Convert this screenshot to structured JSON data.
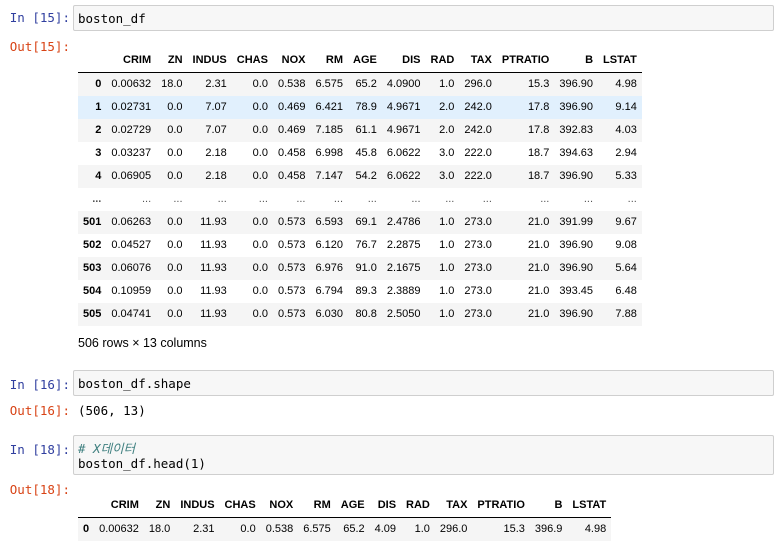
{
  "cells": {
    "c15": {
      "in_prompt": "In [15]:",
      "code": "boston_df",
      "out_prompt": "Out[15]:"
    },
    "c16": {
      "in_prompt": "In [16]:",
      "code": "boston_df.shape",
      "out_prompt": "Out[16]:",
      "output": "(506, 13)"
    },
    "c18": {
      "in_prompt": "In [18]:",
      "comment": "# X데이터",
      "code": "boston_df.head(1)",
      "out_prompt": "Out[18]:"
    }
  },
  "df1": {
    "columns": [
      "CRIM",
      "ZN",
      "INDUS",
      "CHAS",
      "NOX",
      "RM",
      "AGE",
      "DIS",
      "RAD",
      "TAX",
      "PTRATIO",
      "B",
      "LSTAT"
    ],
    "rows": [
      {
        "index": "0",
        "values": [
          "0.00632",
          "18.0",
          "2.31",
          "0.0",
          "0.538",
          "6.575",
          "65.2",
          "4.0900",
          "1.0",
          "296.0",
          "15.3",
          "396.90",
          "4.98"
        ]
      },
      {
        "index": "1",
        "values": [
          "0.02731",
          "0.0",
          "7.07",
          "0.0",
          "0.469",
          "6.421",
          "78.9",
          "4.9671",
          "2.0",
          "242.0",
          "17.8",
          "396.90",
          "9.14"
        ]
      },
      {
        "index": "2",
        "values": [
          "0.02729",
          "0.0",
          "7.07",
          "0.0",
          "0.469",
          "7.185",
          "61.1",
          "4.9671",
          "2.0",
          "242.0",
          "17.8",
          "392.83",
          "4.03"
        ]
      },
      {
        "index": "3",
        "values": [
          "0.03237",
          "0.0",
          "2.18",
          "0.0",
          "0.458",
          "6.998",
          "45.8",
          "6.0622",
          "3.0",
          "222.0",
          "18.7",
          "394.63",
          "2.94"
        ]
      },
      {
        "index": "4",
        "values": [
          "0.06905",
          "0.0",
          "2.18",
          "0.0",
          "0.458",
          "7.147",
          "54.2",
          "6.0622",
          "3.0",
          "222.0",
          "18.7",
          "396.90",
          "5.33"
        ]
      },
      {
        "index": "...",
        "values": [
          "...",
          "...",
          "...",
          "...",
          "...",
          "...",
          "...",
          "...",
          "...",
          "...",
          "...",
          "...",
          "..."
        ]
      },
      {
        "index": "501",
        "values": [
          "0.06263",
          "0.0",
          "11.93",
          "0.0",
          "0.573",
          "6.593",
          "69.1",
          "2.4786",
          "1.0",
          "273.0",
          "21.0",
          "391.99",
          "9.67"
        ]
      },
      {
        "index": "502",
        "values": [
          "0.04527",
          "0.0",
          "11.93",
          "0.0",
          "0.573",
          "6.120",
          "76.7",
          "2.2875",
          "1.0",
          "273.0",
          "21.0",
          "396.90",
          "9.08"
        ]
      },
      {
        "index": "503",
        "values": [
          "0.06076",
          "0.0",
          "11.93",
          "0.0",
          "0.573",
          "6.976",
          "91.0",
          "2.1675",
          "1.0",
          "273.0",
          "21.0",
          "396.90",
          "5.64"
        ]
      },
      {
        "index": "504",
        "values": [
          "0.10959",
          "0.0",
          "11.93",
          "0.0",
          "0.573",
          "6.794",
          "89.3",
          "2.3889",
          "1.0",
          "273.0",
          "21.0",
          "393.45",
          "6.48"
        ]
      },
      {
        "index": "505",
        "values": [
          "0.04741",
          "0.0",
          "11.93",
          "0.0",
          "0.573",
          "6.030",
          "80.8",
          "2.5050",
          "1.0",
          "273.0",
          "21.0",
          "396.90",
          "7.88"
        ]
      }
    ],
    "shape_text": "506 rows × 13 columns"
  },
  "df2": {
    "columns": [
      "CRIM",
      "ZN",
      "INDUS",
      "CHAS",
      "NOX",
      "RM",
      "AGE",
      "DIS",
      "RAD",
      "TAX",
      "PTRATIO",
      "B",
      "LSTAT"
    ],
    "rows": [
      {
        "index": "0",
        "values": [
          "0.00632",
          "18.0",
          "2.31",
          "0.0",
          "0.538",
          "6.575",
          "65.2",
          "4.09",
          "1.0",
          "296.0",
          "15.3",
          "396.9",
          "4.98"
        ]
      }
    ]
  }
}
